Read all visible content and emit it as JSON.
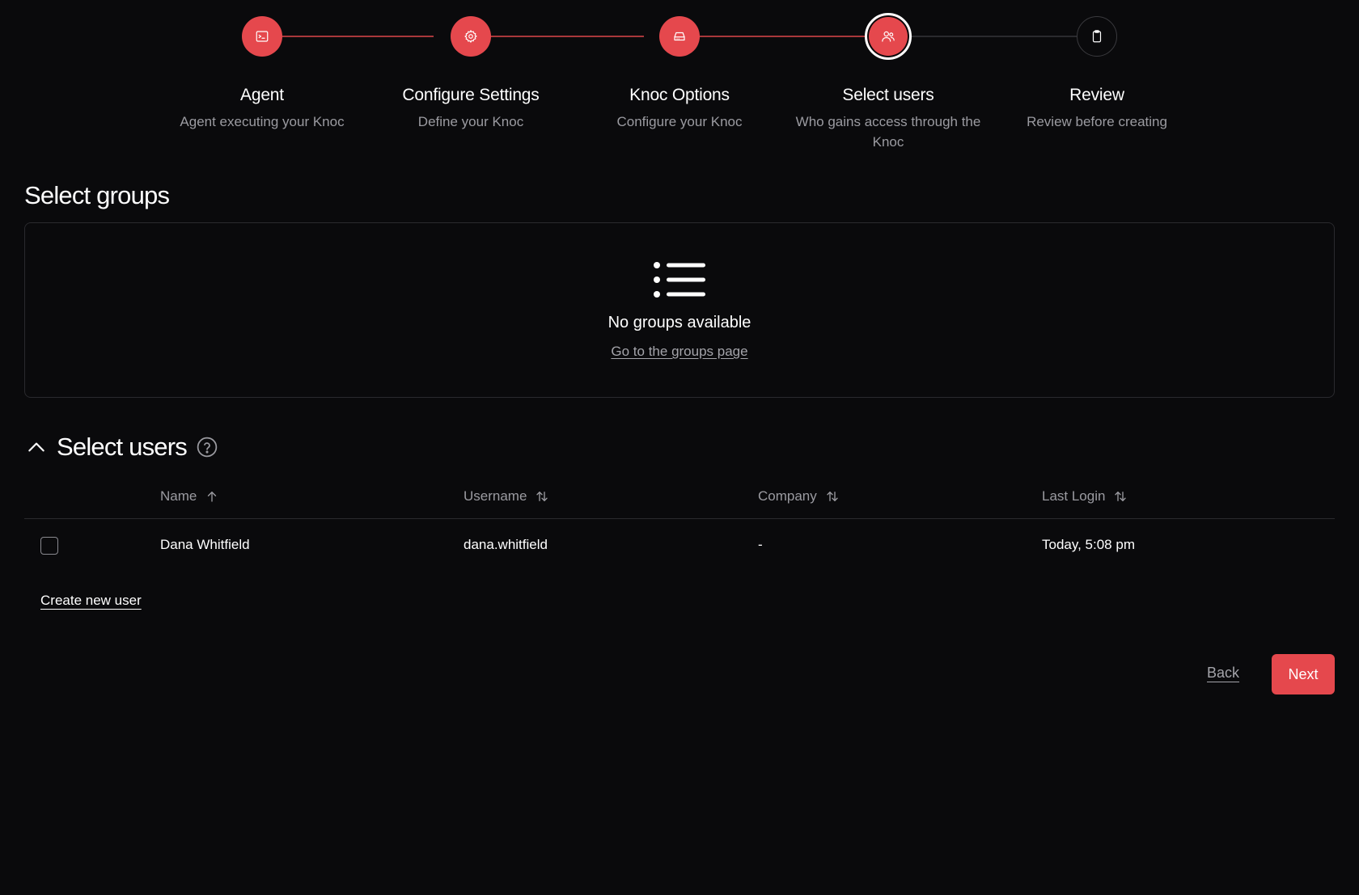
{
  "stepper": {
    "steps": [
      {
        "title": "Agent",
        "subtitle": "Agent executing your Knoc",
        "icon": "terminal-icon",
        "state": "done"
      },
      {
        "title": "Configure Settings",
        "subtitle": "Define your Knoc",
        "icon": "gear-icon",
        "state": "done"
      },
      {
        "title": "Knoc Options",
        "subtitle": "Configure your Knoc",
        "icon": "drive-icon",
        "state": "done"
      },
      {
        "title": "Select users",
        "subtitle": "Who gains access through the Knoc",
        "icon": "users-icon",
        "state": "current"
      },
      {
        "title": "Review",
        "subtitle": "Review before creating",
        "icon": "clipboard-icon",
        "state": "pending"
      }
    ]
  },
  "groups": {
    "title": "Select groups",
    "empty_title": "No groups available",
    "empty_link": "Go to the groups page",
    "icon": "list-icon"
  },
  "users": {
    "title": "Select users",
    "columns": [
      {
        "label": "Name",
        "sort": "ascending"
      },
      {
        "label": "Username",
        "sort": "none"
      },
      {
        "label": "Company",
        "sort": "none"
      },
      {
        "label": "Last Login",
        "sort": "none"
      }
    ],
    "rows": [
      {
        "checked": false,
        "name": "Dana Whitfield",
        "username": "dana.whitfield",
        "company": "-",
        "last_login": "Today, 5:08 pm"
      }
    ],
    "create_link": "Create new user"
  },
  "footer": {
    "back_label": "Back",
    "next_label": "Next"
  },
  "colors": {
    "accent": "#e5484d",
    "background": "#0a0a0c",
    "muted_text": "#9b9ba1",
    "border": "#2a2a2e"
  }
}
